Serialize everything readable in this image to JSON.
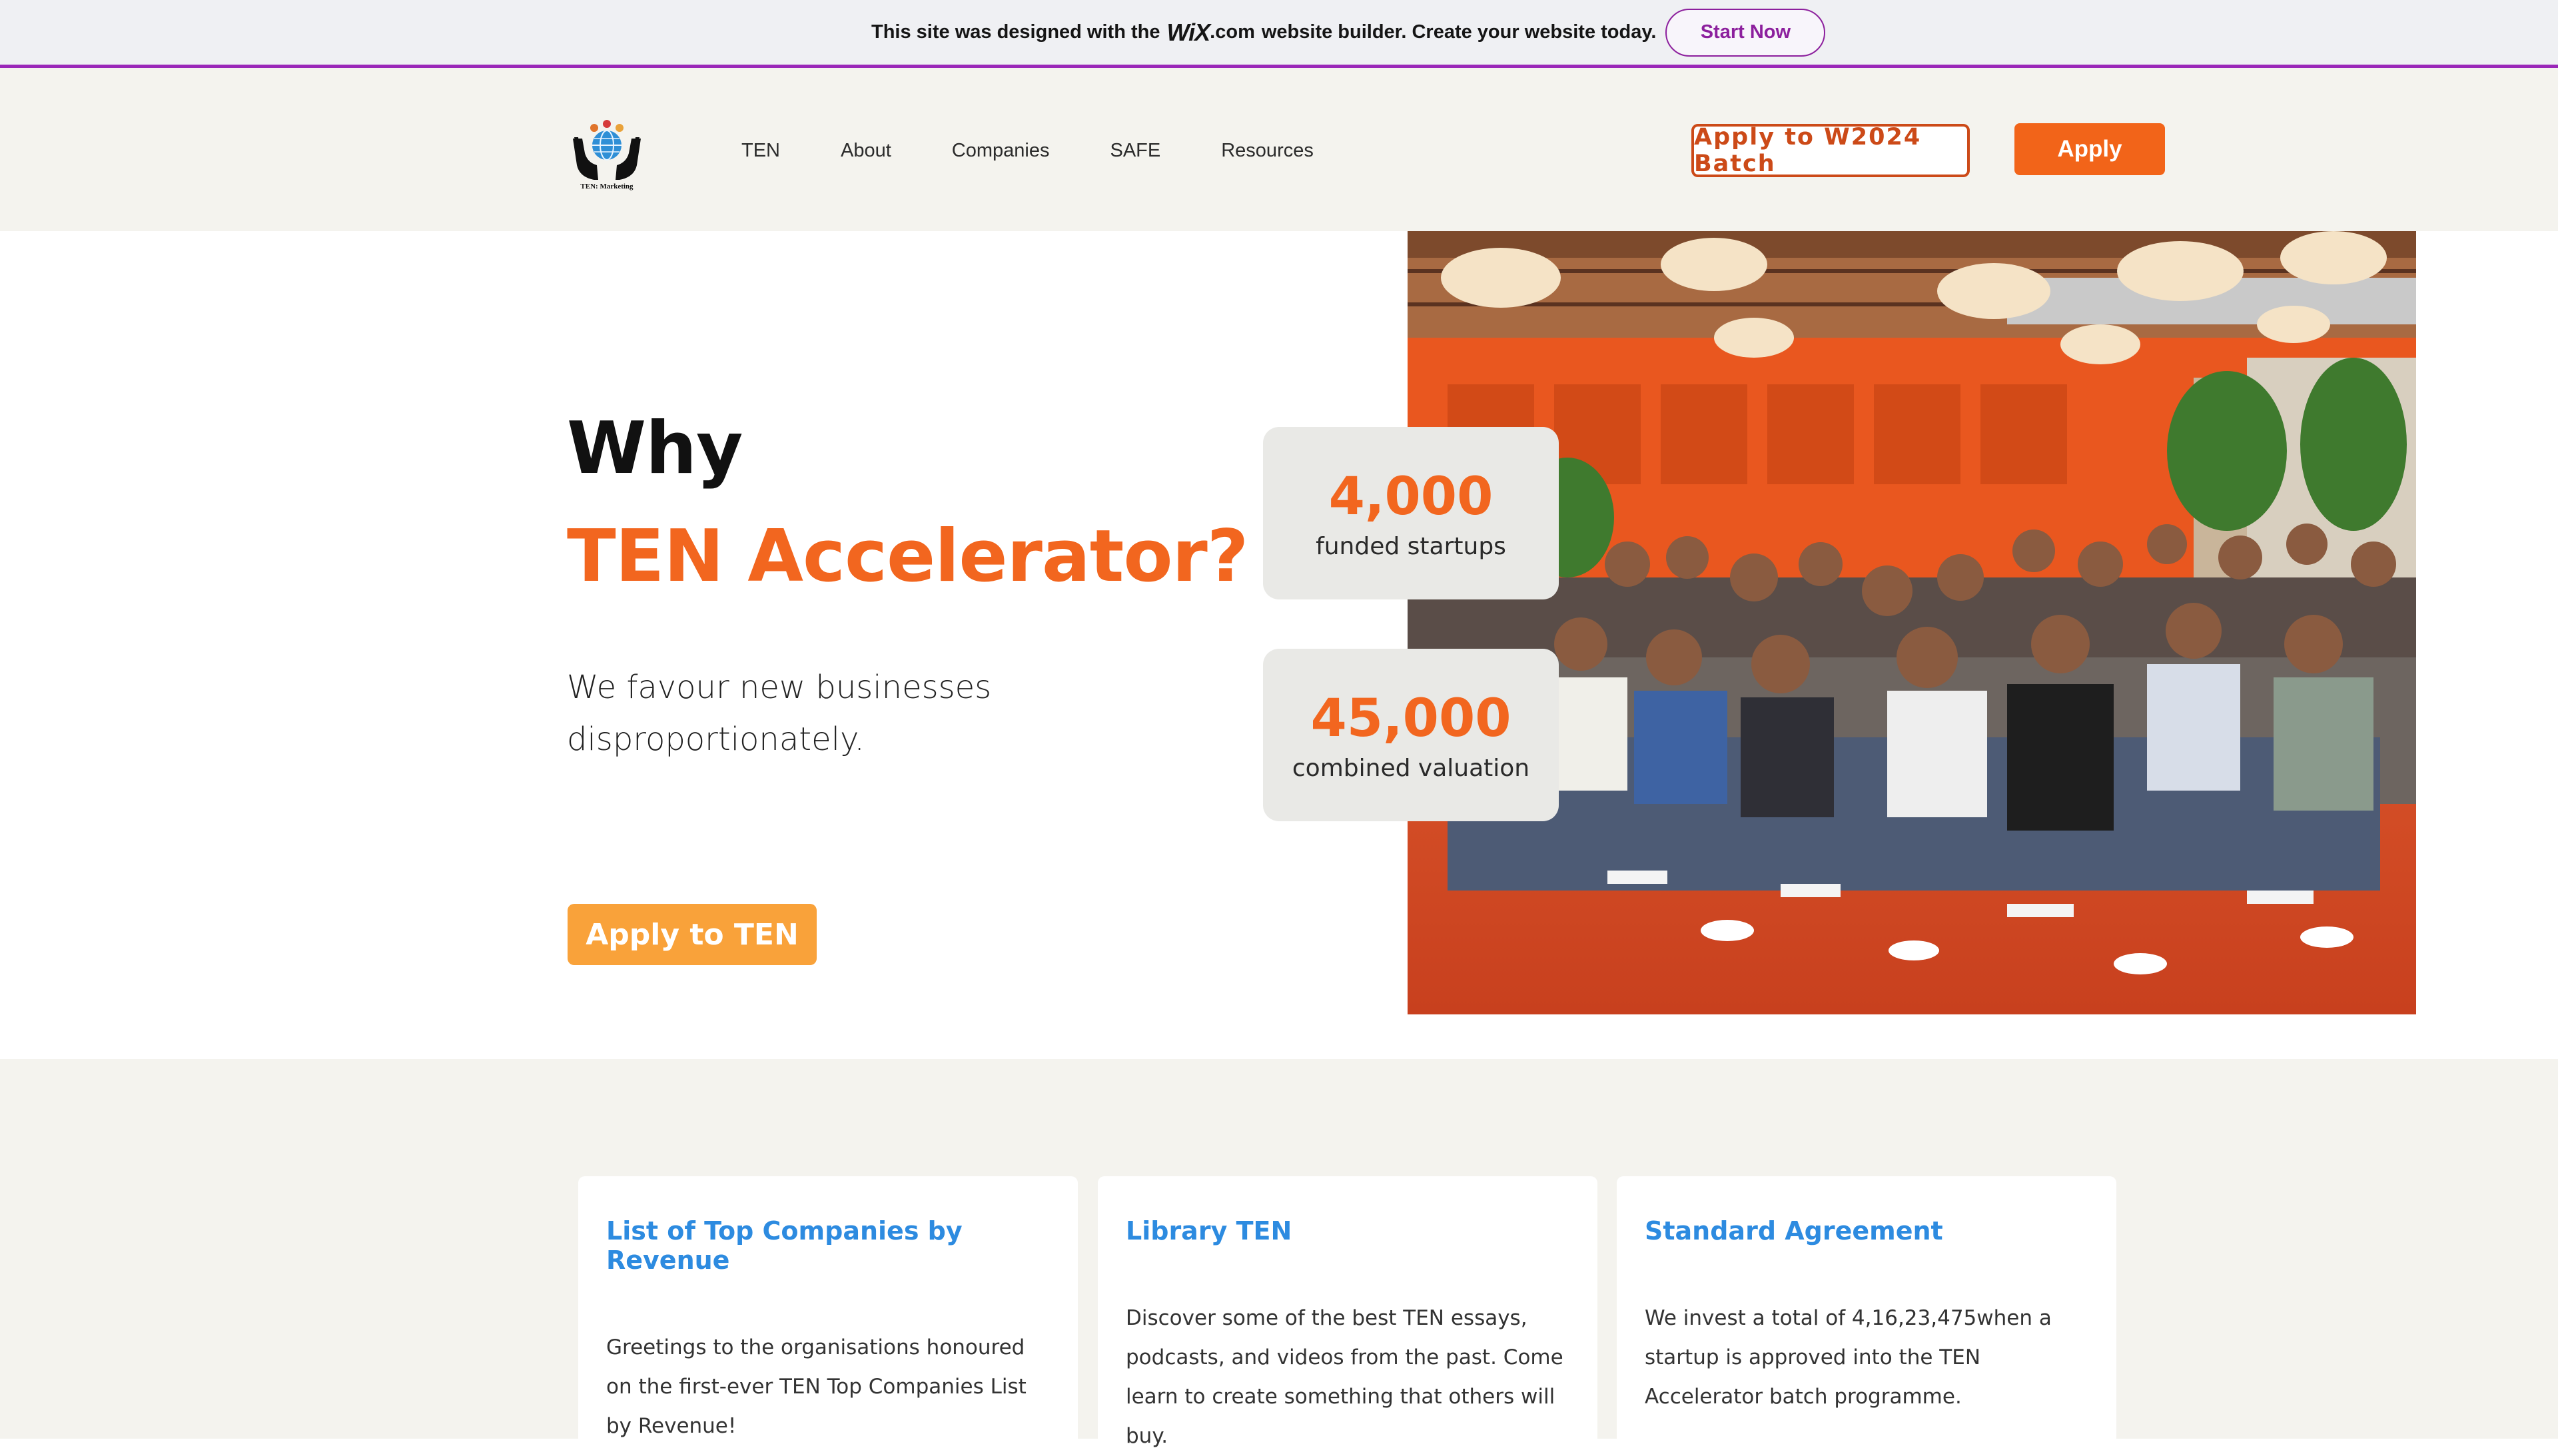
{
  "wix_banner": {
    "text_before": "This site was designed with the",
    "logo": "WiX",
    "logo_suffix": ".com",
    "text_after": "website builder. Create your website today.",
    "cta": "Start Now",
    "accent_color": "#9a27b8"
  },
  "header": {
    "logo_icon": "hands-globe-logo",
    "logo_caption": "TEN: Marketing",
    "nav": [
      "TEN",
      "About",
      "Companies",
      "SAFE",
      "Resources"
    ],
    "batch_button": "Apply to W2024 Batch",
    "apply_button": "Apply",
    "brand_color": "#f26419"
  },
  "hero": {
    "title_line1": "Why",
    "title_line2": "TEN Accelerator?",
    "subtitle": "We favour new businesses disproportionately.",
    "cta": "Apply to TEN",
    "stats": [
      {
        "value": "4,000",
        "label": "funded startups"
      },
      {
        "value": "45,000",
        "label": "combined valuation"
      }
    ]
  },
  "cards": [
    {
      "title": "List of Top Companies by Revenue",
      "body": "Greetings to the organisations honoured on the first-ever TEN Top Companies List by Revenue!"
    },
    {
      "title": "Library TEN",
      "body": "Discover some of the best TEN essays, podcasts, and videos from the past. Come learn to create something that others will buy."
    },
    {
      "title": "Standard Agreement",
      "body": "We invest a total of 4,16,23,475when a startup is approved into the TEN Accelerator batch programme."
    }
  ]
}
